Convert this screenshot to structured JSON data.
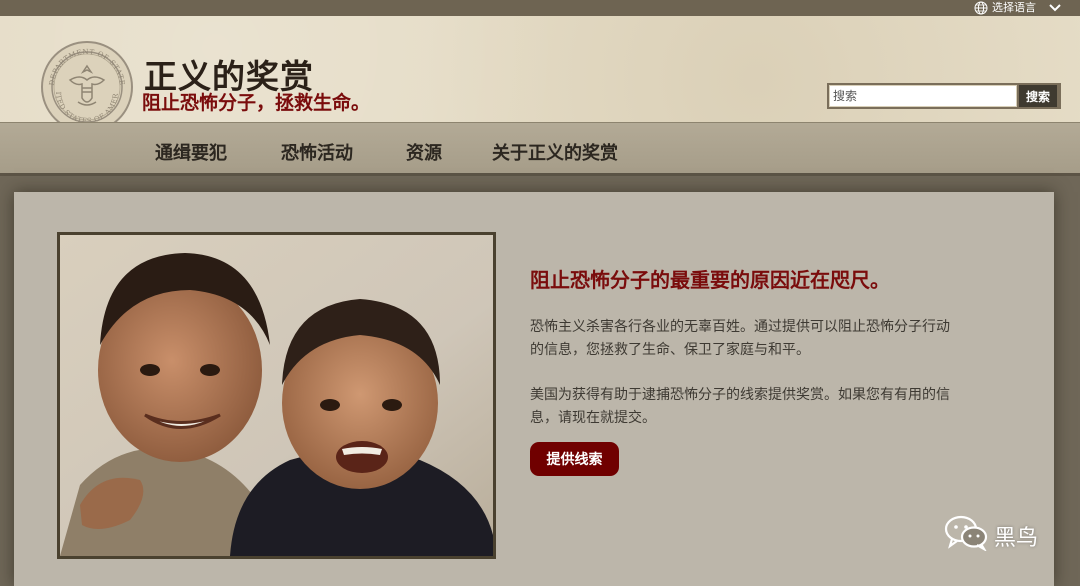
{
  "topbar": {
    "language_label": "选择语言",
    "globe_icon": "globe-icon",
    "dropdown_icon": "chevron-down-icon"
  },
  "header": {
    "seal_icon": "department-of-state-seal",
    "title": "正义的奖赏",
    "tagline": "阻止恐怖分子，拯救生命。",
    "search": {
      "placeholder": "搜索",
      "button_label": "搜索"
    }
  },
  "nav": {
    "items": [
      {
        "label": "通缉要犯"
      },
      {
        "label": "恐怖活动"
      },
      {
        "label": "资源"
      },
      {
        "label": "关于正义的奖赏"
      }
    ]
  },
  "feature": {
    "image": "two-smiling-children-photo",
    "headline": "阻止恐怖分子的最重要的原因近在咫尺。",
    "paragraph1_line1": "恐怖主义杀害各行各业的无辜百姓。通过提供可以阻止恐怖分子行动",
    "paragraph1_line2": "的信息，您拯救了生命、保卫了家庭与和平。",
    "paragraph2_line1": "美国为获得有助于逮捕恐怖分子的线索提供奖赏。如果您有有用的信",
    "paragraph2_line2": "息，请现在就提交。",
    "button_label": "提供线索"
  },
  "watermark": {
    "icon": "wechat-icon",
    "text": "黑鸟"
  },
  "colors": {
    "tagline_red": "#7a0c0c",
    "button_red": "#700000",
    "header_beige": "#e5dcc6",
    "nav_bg": "#aca38f",
    "panel_bg": "#bcb6aa"
  }
}
